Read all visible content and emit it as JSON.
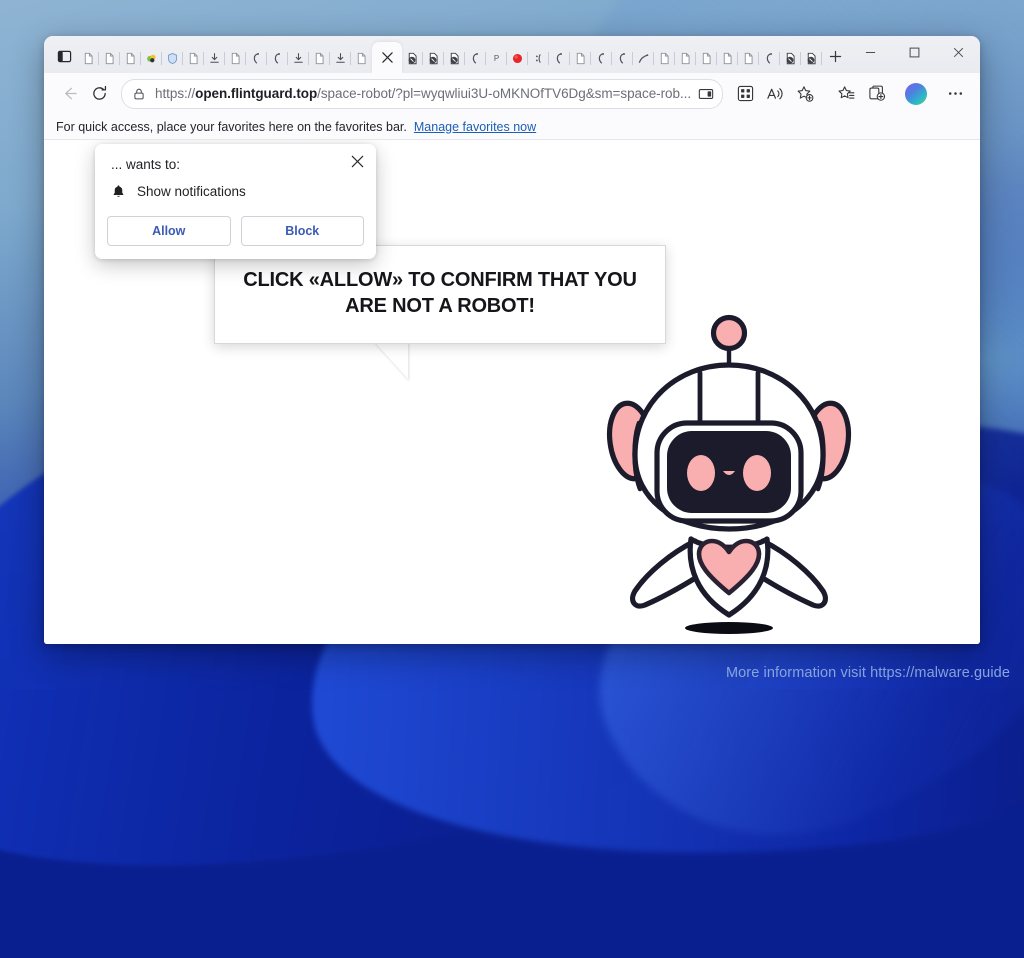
{
  "desktop": {
    "watermark": "More information visit https://malware.guide"
  },
  "browser": {
    "tabstrip": {
      "tab_search_icon": "tab-search-icon",
      "new_tab_icon": "plus-icon",
      "active_tab_index": 13,
      "tabs": [
        {
          "icon": "page-icon",
          "type": "page"
        },
        {
          "icon": "page-icon",
          "type": "page"
        },
        {
          "icon": "page-icon",
          "type": "page"
        },
        {
          "icon": "turtle-icon",
          "type": "color"
        },
        {
          "icon": "shield-icon",
          "type": "shield"
        },
        {
          "icon": "page-icon",
          "type": "page"
        },
        {
          "icon": "download-icon",
          "type": "download"
        },
        {
          "icon": "page-icon",
          "type": "page"
        },
        {
          "icon": "hook-icon",
          "type": "hook"
        },
        {
          "icon": "hook-icon",
          "type": "hook"
        },
        {
          "icon": "download-icon",
          "type": "download"
        },
        {
          "icon": "page-icon",
          "type": "page"
        },
        {
          "icon": "download-icon",
          "type": "download"
        },
        {
          "icon": "page-icon",
          "type": "page"
        },
        {
          "icon": "close-icon",
          "type": "active"
        },
        {
          "icon": "blocked-page-icon",
          "type": "blocked"
        },
        {
          "icon": "blocked-page-icon",
          "type": "blocked"
        },
        {
          "icon": "blocked-page-icon",
          "type": "blocked"
        },
        {
          "icon": "hook-icon",
          "type": "hook"
        },
        {
          "icon": "text-icon",
          "type": "text",
          "label": "P"
        },
        {
          "icon": "red-circle-icon",
          "type": "red"
        },
        {
          "icon": "dots-icon",
          "type": "dots"
        },
        {
          "icon": "hook-icon",
          "type": "hook"
        },
        {
          "icon": "page-icon",
          "type": "page"
        },
        {
          "icon": "hook-icon",
          "type": "hook"
        },
        {
          "icon": "hook-icon",
          "type": "hook"
        },
        {
          "icon": "arc-icon",
          "type": "arc"
        },
        {
          "icon": "page-icon",
          "type": "page"
        },
        {
          "icon": "page-icon",
          "type": "page"
        },
        {
          "icon": "page-icon",
          "type": "page"
        },
        {
          "icon": "page-icon",
          "type": "page"
        },
        {
          "icon": "page-icon",
          "type": "page"
        },
        {
          "icon": "hook-icon",
          "type": "hook"
        },
        {
          "icon": "blocked-page-icon",
          "type": "blocked"
        },
        {
          "icon": "blocked-page-icon",
          "type": "blocked"
        },
        {
          "icon": "blocked-page-icon",
          "type": "blocked"
        },
        {
          "icon": "blocked-page-icon",
          "type": "blocked"
        },
        {
          "icon": "blocked-page-icon",
          "type": "blocked"
        },
        {
          "icon": "blocked-page-icon",
          "type": "blocked"
        },
        {
          "icon": "blocked-page-icon",
          "type": "blocked"
        }
      ]
    },
    "window_controls": {
      "minimize": "minimize-icon",
      "maximize": "maximize-icon",
      "close": "close-icon"
    },
    "toolbar": {
      "back_icon": "back-arrow-icon",
      "refresh_icon": "refresh-icon",
      "site_info_icon": "lock-icon",
      "url_prefix": "https://",
      "url_domain": "open.flintguard.top",
      "url_path": "/space-robot/?pl=wyqwliui3U-oMKNOfTV6Dg&sm=space-rob...",
      "url_full": "https://open.flintguard.top/space-robot/?pl=wyqwliui3U-oMKNOfTV6Dg&sm=space-rob...",
      "right_icons": [
        "split-screen-icon",
        "collections-grid-icon",
        "read-aloud-icon",
        "add-favorite-icon",
        "favorites-icon",
        "collections-icon"
      ],
      "avatar": "profile-avatar",
      "settings_icon": "more-options-icon"
    },
    "favorites_bar": {
      "hint": "For quick access, place your favorites here on the favorites bar.",
      "manage_link": "Manage favorites now"
    }
  },
  "permission_dialog": {
    "title": "... wants to:",
    "bell_icon": "bell-icon",
    "permission_label": "Show notifications",
    "allow_label": "Allow",
    "block_label": "Block",
    "close_icon": "close-icon"
  },
  "page_content": {
    "bubble_text": "CLICK «ALLOW» TO CONFIRM THAT YOU ARE NOT A ROBOT!",
    "robot_illustration": "space-robot-mascot"
  },
  "colors": {
    "accent_blue": "#3b5bb5",
    "link_blue": "#1b5fb5",
    "robot_pink": "#f9aeb0",
    "robot_dark": "#1b1b2b",
    "watermark_blue": "#a6c4f0"
  }
}
